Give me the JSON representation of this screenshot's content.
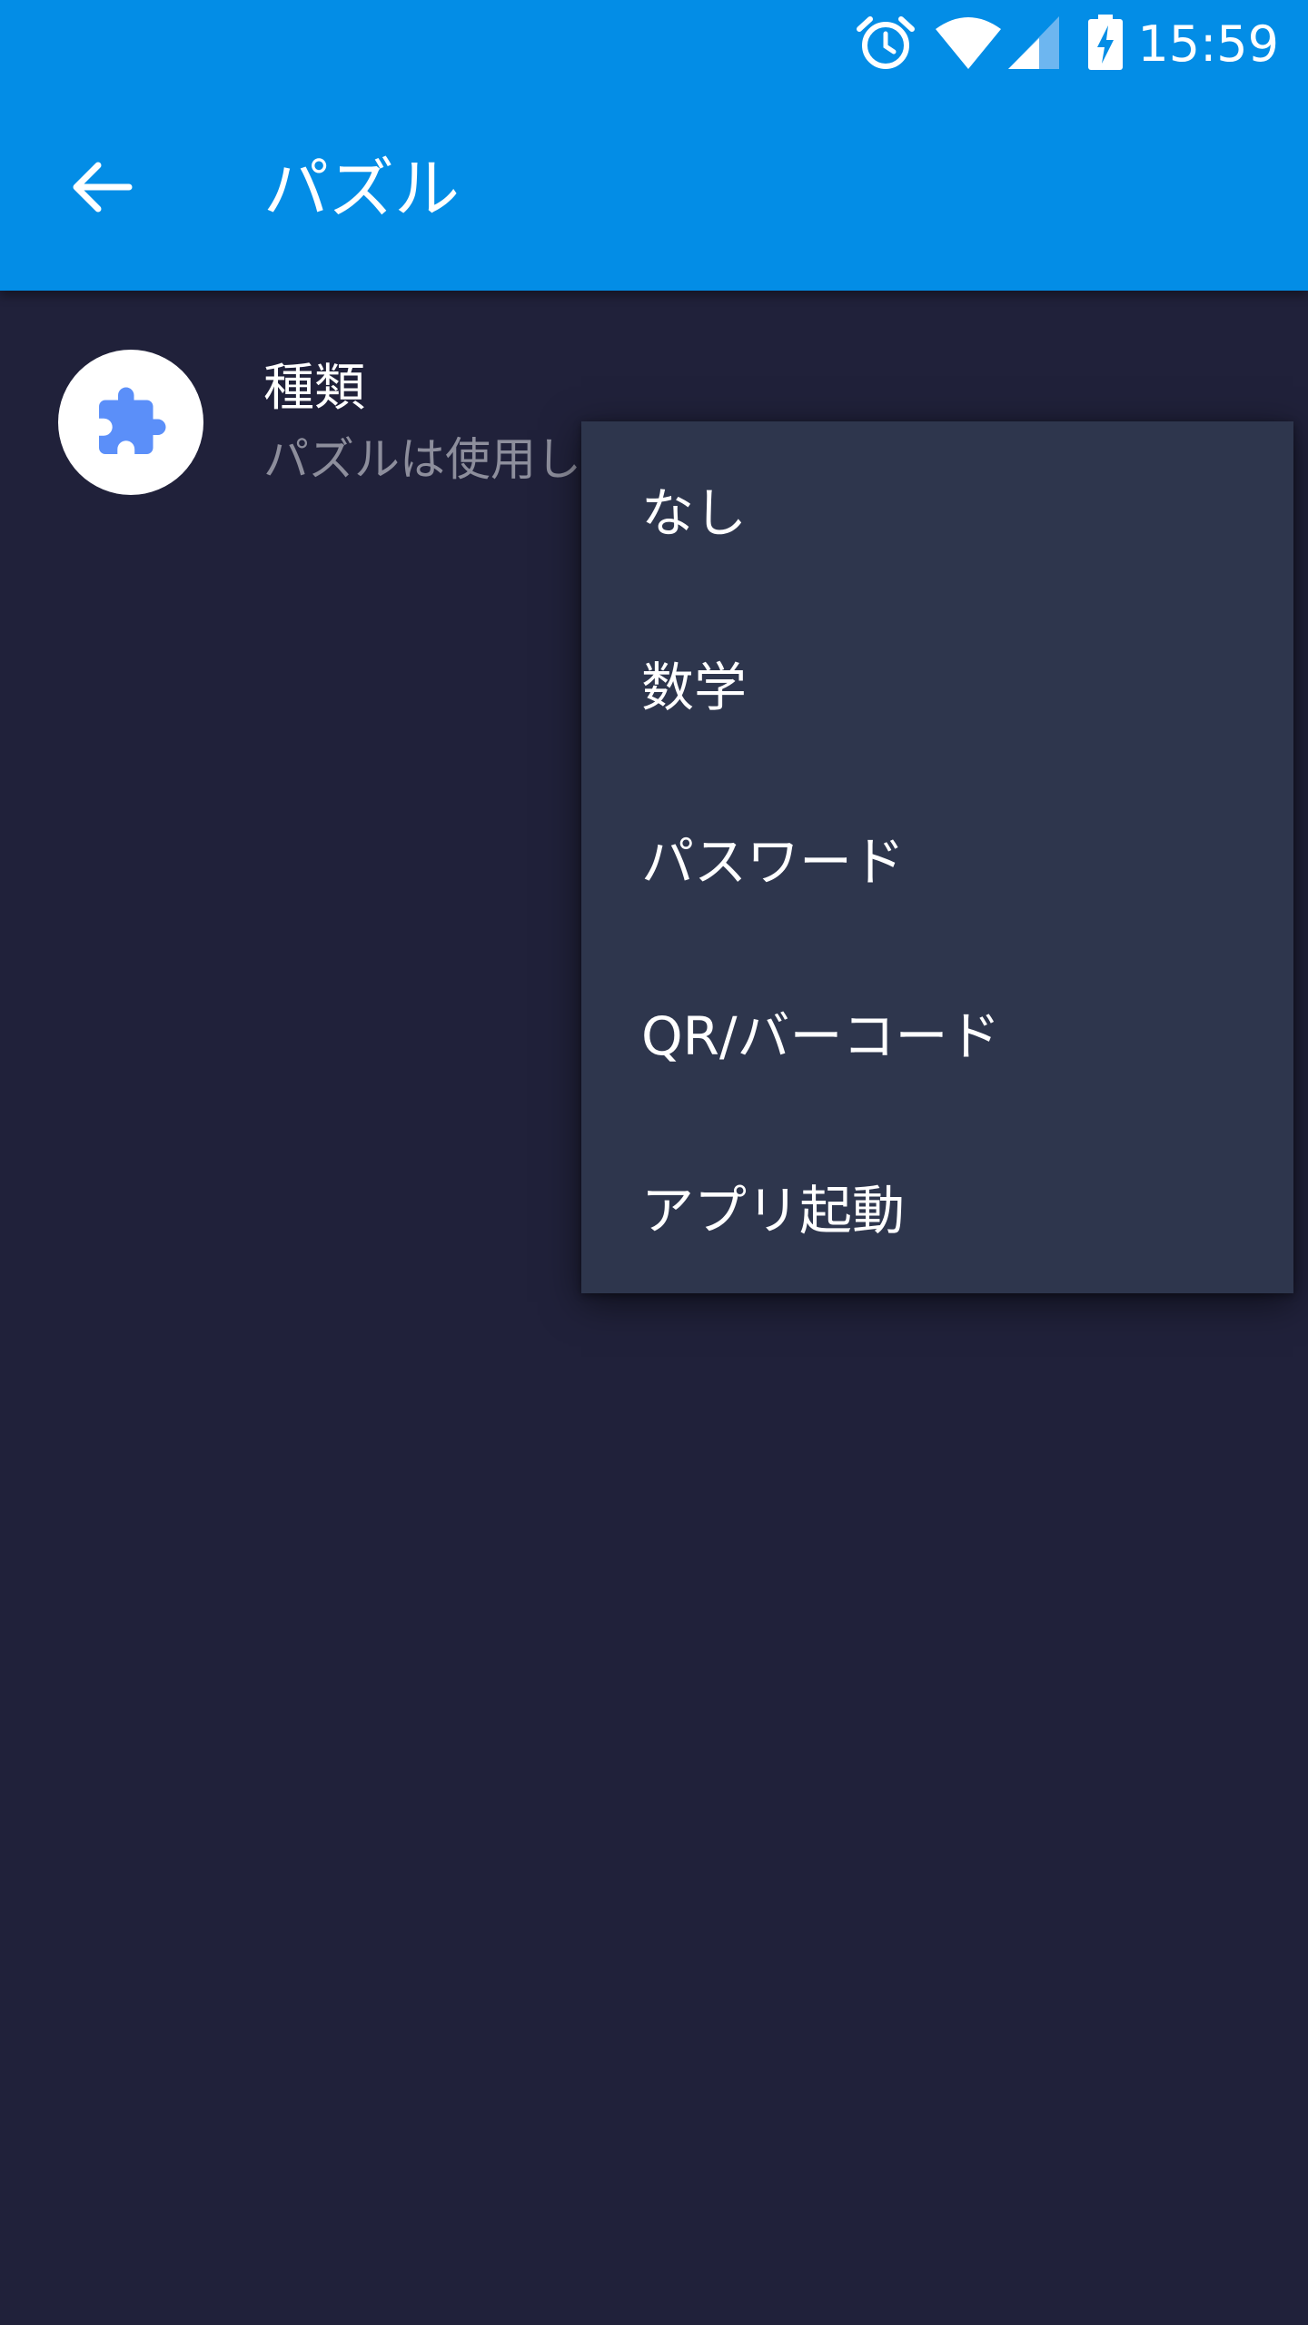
{
  "status_bar": {
    "time": "15:59",
    "icons": [
      "alarm-icon",
      "wifi-icon",
      "signal-icon",
      "battery-charging-icon"
    ]
  },
  "app_bar": {
    "back_icon": "arrow-back-icon",
    "title": "パズル",
    "color": "#038de6"
  },
  "setting": {
    "icon": "puzzle-icon",
    "title": "種類",
    "subtitle": "パズルは使用し"
  },
  "menu": {
    "items": [
      {
        "label": "なし"
      },
      {
        "label": "数学"
      },
      {
        "label": "パスワード"
      },
      {
        "label": "QR/バーコード"
      },
      {
        "label": "アプリ起動"
      }
    ]
  },
  "colors": {
    "background": "#20213a",
    "menu_background": "#2e364d",
    "accent": "#5b8ff9"
  }
}
